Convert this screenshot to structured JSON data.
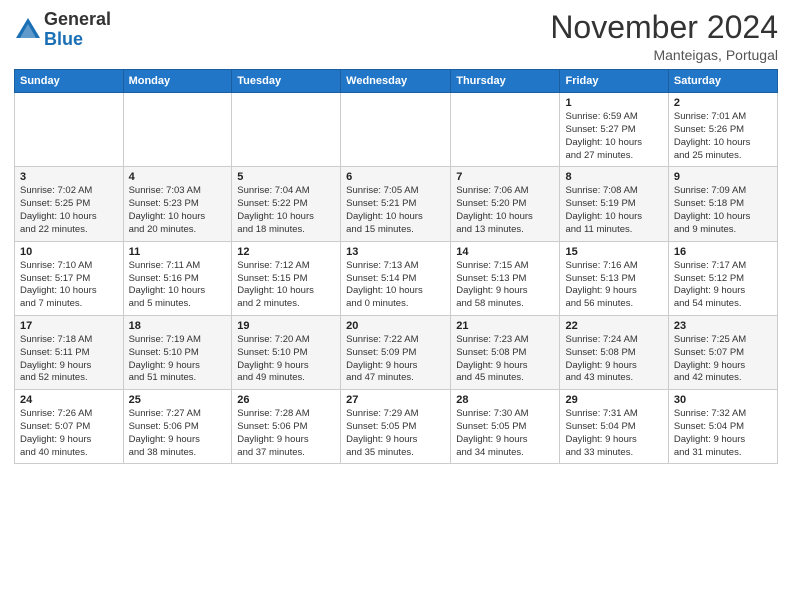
{
  "logo": {
    "general": "General",
    "blue": "Blue"
  },
  "header": {
    "month": "November 2024",
    "location": "Manteigas, Portugal"
  },
  "weekdays": [
    "Sunday",
    "Monday",
    "Tuesday",
    "Wednesday",
    "Thursday",
    "Friday",
    "Saturday"
  ],
  "weeks": [
    [
      {
        "day": "",
        "info": ""
      },
      {
        "day": "",
        "info": ""
      },
      {
        "day": "",
        "info": ""
      },
      {
        "day": "",
        "info": ""
      },
      {
        "day": "",
        "info": ""
      },
      {
        "day": "1",
        "info": "Sunrise: 6:59 AM\nSunset: 5:27 PM\nDaylight: 10 hours\nand 27 minutes."
      },
      {
        "day": "2",
        "info": "Sunrise: 7:01 AM\nSunset: 5:26 PM\nDaylight: 10 hours\nand 25 minutes."
      }
    ],
    [
      {
        "day": "3",
        "info": "Sunrise: 7:02 AM\nSunset: 5:25 PM\nDaylight: 10 hours\nand 22 minutes."
      },
      {
        "day": "4",
        "info": "Sunrise: 7:03 AM\nSunset: 5:23 PM\nDaylight: 10 hours\nand 20 minutes."
      },
      {
        "day": "5",
        "info": "Sunrise: 7:04 AM\nSunset: 5:22 PM\nDaylight: 10 hours\nand 18 minutes."
      },
      {
        "day": "6",
        "info": "Sunrise: 7:05 AM\nSunset: 5:21 PM\nDaylight: 10 hours\nand 15 minutes."
      },
      {
        "day": "7",
        "info": "Sunrise: 7:06 AM\nSunset: 5:20 PM\nDaylight: 10 hours\nand 13 minutes."
      },
      {
        "day": "8",
        "info": "Sunrise: 7:08 AM\nSunset: 5:19 PM\nDaylight: 10 hours\nand 11 minutes."
      },
      {
        "day": "9",
        "info": "Sunrise: 7:09 AM\nSunset: 5:18 PM\nDaylight: 10 hours\nand 9 minutes."
      }
    ],
    [
      {
        "day": "10",
        "info": "Sunrise: 7:10 AM\nSunset: 5:17 PM\nDaylight: 10 hours\nand 7 minutes."
      },
      {
        "day": "11",
        "info": "Sunrise: 7:11 AM\nSunset: 5:16 PM\nDaylight: 10 hours\nand 5 minutes."
      },
      {
        "day": "12",
        "info": "Sunrise: 7:12 AM\nSunset: 5:15 PM\nDaylight: 10 hours\nand 2 minutes."
      },
      {
        "day": "13",
        "info": "Sunrise: 7:13 AM\nSunset: 5:14 PM\nDaylight: 10 hours\nand 0 minutes."
      },
      {
        "day": "14",
        "info": "Sunrise: 7:15 AM\nSunset: 5:13 PM\nDaylight: 9 hours\nand 58 minutes."
      },
      {
        "day": "15",
        "info": "Sunrise: 7:16 AM\nSunset: 5:13 PM\nDaylight: 9 hours\nand 56 minutes."
      },
      {
        "day": "16",
        "info": "Sunrise: 7:17 AM\nSunset: 5:12 PM\nDaylight: 9 hours\nand 54 minutes."
      }
    ],
    [
      {
        "day": "17",
        "info": "Sunrise: 7:18 AM\nSunset: 5:11 PM\nDaylight: 9 hours\nand 52 minutes."
      },
      {
        "day": "18",
        "info": "Sunrise: 7:19 AM\nSunset: 5:10 PM\nDaylight: 9 hours\nand 51 minutes."
      },
      {
        "day": "19",
        "info": "Sunrise: 7:20 AM\nSunset: 5:10 PM\nDaylight: 9 hours\nand 49 minutes."
      },
      {
        "day": "20",
        "info": "Sunrise: 7:22 AM\nSunset: 5:09 PM\nDaylight: 9 hours\nand 47 minutes."
      },
      {
        "day": "21",
        "info": "Sunrise: 7:23 AM\nSunset: 5:08 PM\nDaylight: 9 hours\nand 45 minutes."
      },
      {
        "day": "22",
        "info": "Sunrise: 7:24 AM\nSunset: 5:08 PM\nDaylight: 9 hours\nand 43 minutes."
      },
      {
        "day": "23",
        "info": "Sunrise: 7:25 AM\nSunset: 5:07 PM\nDaylight: 9 hours\nand 42 minutes."
      }
    ],
    [
      {
        "day": "24",
        "info": "Sunrise: 7:26 AM\nSunset: 5:07 PM\nDaylight: 9 hours\nand 40 minutes."
      },
      {
        "day": "25",
        "info": "Sunrise: 7:27 AM\nSunset: 5:06 PM\nDaylight: 9 hours\nand 38 minutes."
      },
      {
        "day": "26",
        "info": "Sunrise: 7:28 AM\nSunset: 5:06 PM\nDaylight: 9 hours\nand 37 minutes."
      },
      {
        "day": "27",
        "info": "Sunrise: 7:29 AM\nSunset: 5:05 PM\nDaylight: 9 hours\nand 35 minutes."
      },
      {
        "day": "28",
        "info": "Sunrise: 7:30 AM\nSunset: 5:05 PM\nDaylight: 9 hours\nand 34 minutes."
      },
      {
        "day": "29",
        "info": "Sunrise: 7:31 AM\nSunset: 5:04 PM\nDaylight: 9 hours\nand 33 minutes."
      },
      {
        "day": "30",
        "info": "Sunrise: 7:32 AM\nSunset: 5:04 PM\nDaylight: 9 hours\nand 31 minutes."
      }
    ]
  ]
}
